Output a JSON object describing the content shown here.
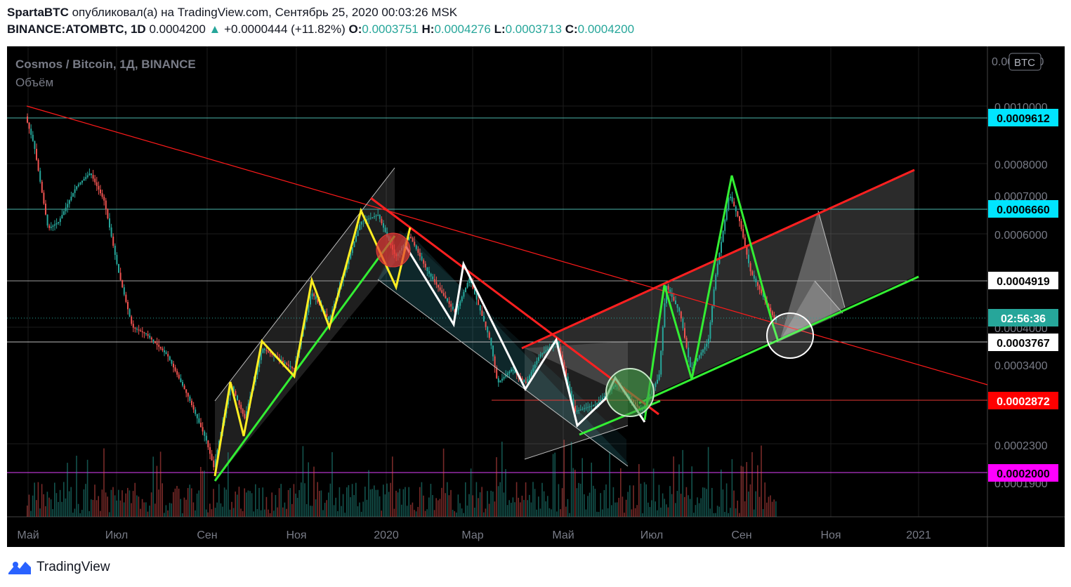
{
  "header": {
    "author": "SpartaBTC",
    "published_text": "опубликовал(а) на TradingView.com, Сентябрь 25, 2020 00:03:26 MSK",
    "symbol": "BINANCE:ATOMBTC, 1D",
    "price": "0.0004200",
    "change_arrow": "▲",
    "change": "+0.0000444 (+11.82%)",
    "o_label": "O:",
    "o_val": "0.0003751",
    "h_label": "H:",
    "h_val": "0.0004276",
    "l_label": "L:",
    "l_val": "0.0003713",
    "c_label": "C:",
    "c_val": "0.0004200"
  },
  "legend": {
    "title": "Cosmos / Bitcoin, 1Д, BINANCE",
    "volume": "Объём"
  },
  "currency_badge": "BTC",
  "footer": {
    "brand": "TradingView"
  },
  "chart_data": {
    "type": "candlestick",
    "symbol": "ATOMBTC",
    "price_axis_ticks": [
      "0.0010000",
      "0.0008000",
      "0.0007000",
      "0.0006000",
      "0.0004000",
      "0.0003400",
      "0.0002300",
      "0.0001900"
    ],
    "partial_top_tick": "0.0011000",
    "x_axis_ticks": [
      "Май",
      "Июл",
      "Сен",
      "Ноя",
      "2020",
      "Мар",
      "Май",
      "Июл",
      "Сен",
      "Ноя",
      "2021"
    ],
    "price_labels": [
      {
        "value": "0.0009612",
        "color": "#00e5ff",
        "text_color": "#000000"
      },
      {
        "value": "0.0006660",
        "color": "#00e5ff",
        "text_color": "#000000"
      },
      {
        "value": "0.0004919",
        "color": "#ffffff",
        "text_color": "#000000"
      },
      {
        "value": "02:56:36",
        "color": "#26a69a",
        "text_color": "#ffffff"
      },
      {
        "value": "0.0003767",
        "color": "#ffffff",
        "text_color": "#000000"
      },
      {
        "value": "0.0002872",
        "color": "#ff0000",
        "text_color": "#ffffff"
      },
      {
        "value": "0.0002000",
        "color": "#ff00ff",
        "text_color": "#000000"
      }
    ],
    "horizontal_levels": [
      {
        "value": 0.0009612,
        "color": "#4db6ac"
      },
      {
        "value": 0.000666,
        "color": "#4db6ac"
      },
      {
        "value": 0.0004919,
        "color": "#9e9e9e"
      },
      {
        "value": 0.0003767,
        "color": "#bdbdbd"
      },
      {
        "value": 0.0002872,
        "color": "#e53935"
      },
      {
        "value": 0.0002,
        "color": "#e040fb"
      }
    ],
    "last_close": 0.00042,
    "colors": {
      "up": "#26a69a",
      "down": "#ef5350",
      "background": "#000000"
    }
  }
}
